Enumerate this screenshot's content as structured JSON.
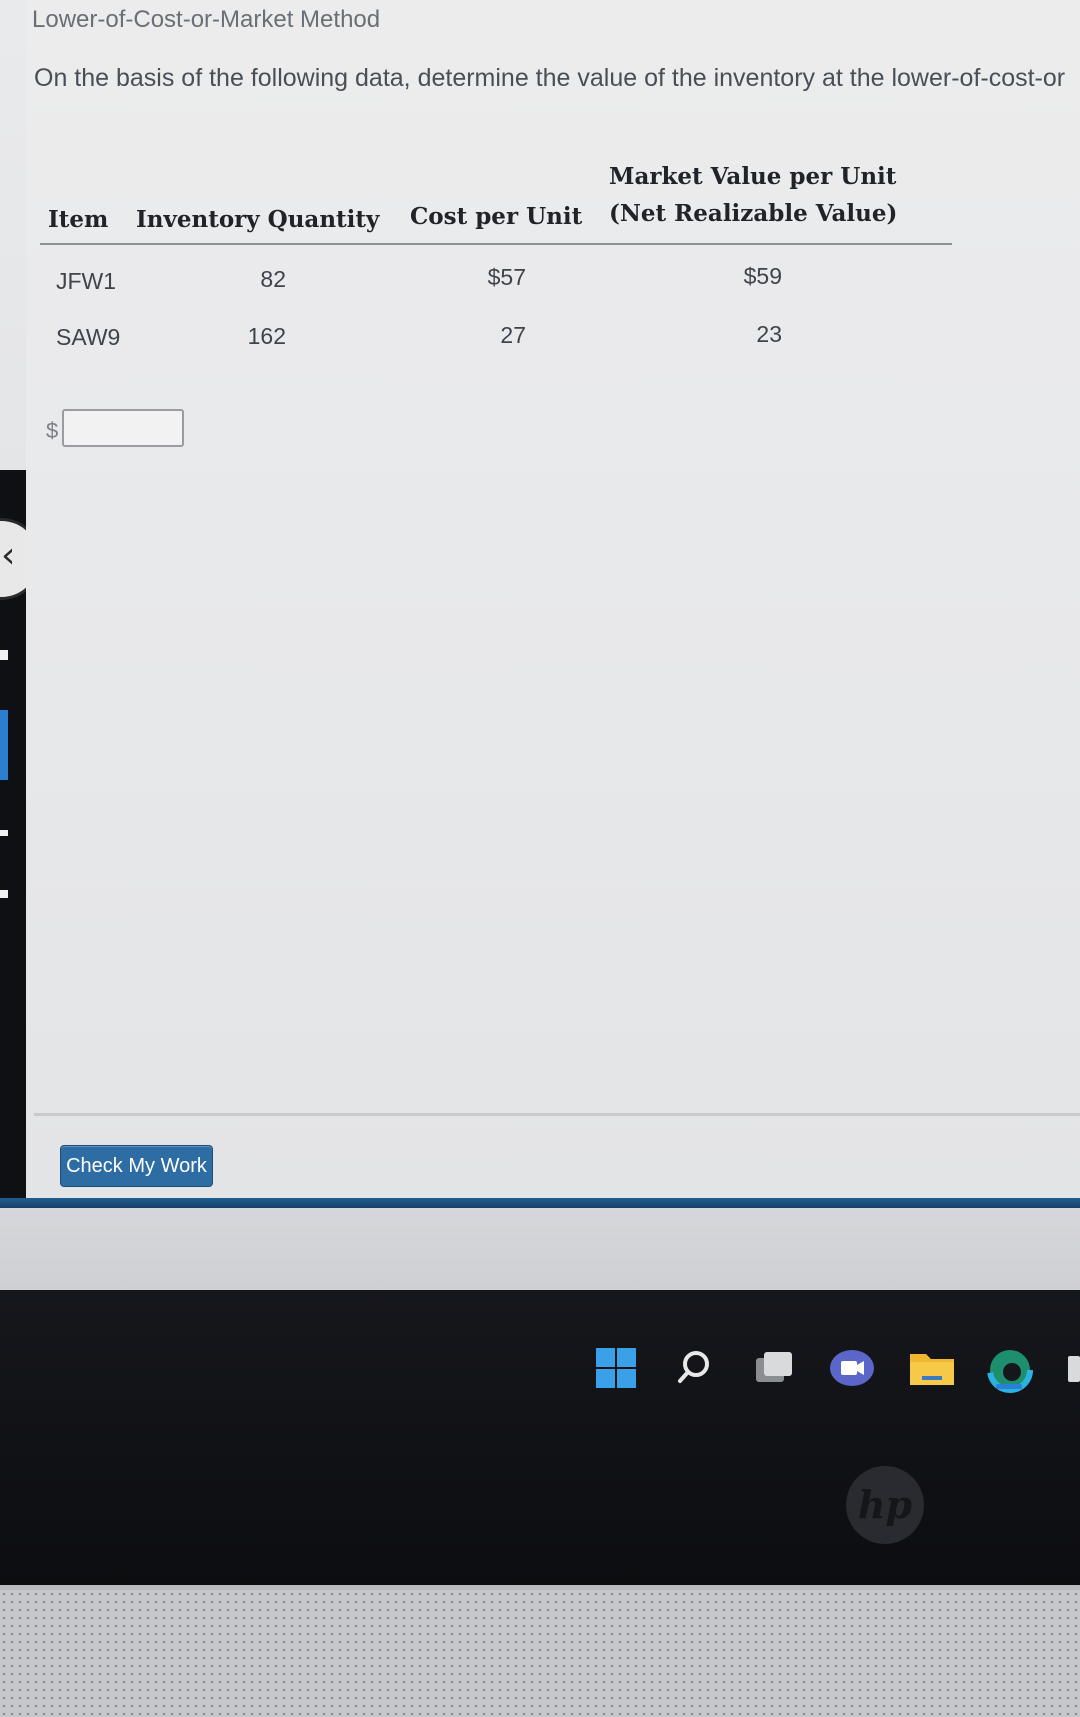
{
  "assignment": {
    "title": "Lower-of-Cost-or-Market Method",
    "instruction": "On the basis of the following data, determine the value of the inventory at the lower-of-cost-or"
  },
  "table": {
    "headers": {
      "item": "Item",
      "quantity": "Inventory Quantity",
      "cost": "Cost per Unit",
      "market_line1": "Market Value per Unit",
      "market_line2": "(Net Realizable Value)"
    },
    "rows": [
      {
        "item": "JFW1",
        "quantity": "82",
        "cost": "$57",
        "market": "$59"
      },
      {
        "item": "SAW9",
        "quantity": "162",
        "cost": "27",
        "market": "23"
      }
    ]
  },
  "answer": {
    "currency_symbol": "$",
    "value": ""
  },
  "actions": {
    "check_label": "Check My Work"
  },
  "taskbar": {
    "icons": [
      "windows-start-icon",
      "search-icon",
      "task-view-icon",
      "teams-chat-icon",
      "file-explorer-icon",
      "edge-browser-icon"
    ]
  },
  "device": {
    "logo_text": "hp"
  }
}
